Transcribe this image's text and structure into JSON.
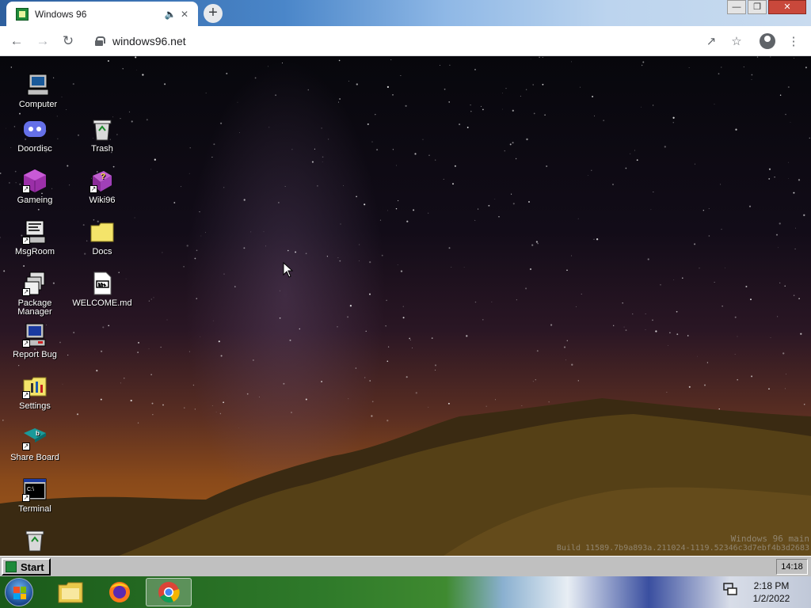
{
  "browser": {
    "tab_title": "Windows 96",
    "tab_audio_icon": "speaker-icon",
    "tab_close_icon": "close-icon",
    "new_tab_label": "+",
    "url": "windows96.net",
    "window_controls": [
      "minimize",
      "restore",
      "close"
    ]
  },
  "desktop": {
    "icons": [
      {
        "label": "Computer",
        "icon": "computer-icon"
      },
      {
        "label": "Doordisc",
        "icon": "discord-icon"
      },
      {
        "label": "Trash",
        "icon": "recycle-bin-icon"
      },
      {
        "label": "Gameing",
        "icon": "game-cube-icon"
      },
      {
        "label": "Wiki96",
        "icon": "help-book-icon"
      },
      {
        "label": "MsgRoom",
        "icon": "chat-icon"
      },
      {
        "label": "Docs",
        "icon": "folder-icon"
      },
      {
        "label": "Package Manager",
        "icon": "package-icon"
      },
      {
        "label": "WELCOME.md",
        "icon": "markdown-file-icon"
      },
      {
        "label": "Report Bug",
        "icon": "bug-report-icon"
      },
      {
        "label": "Settings",
        "icon": "settings-folder-icon"
      },
      {
        "label": "Share Board",
        "icon": "share-board-icon"
      },
      {
        "label": "Terminal",
        "icon": "terminal-icon"
      }
    ],
    "build_line1": "Windows 96 main",
    "build_line2": "Build 11589.7b9a893a.211024-1119.52346c3d7ebf4b3d2683"
  },
  "w96_taskbar": {
    "start_label": "Start",
    "clock": "14:18"
  },
  "host_taskbar": {
    "apps": [
      "file-explorer-icon",
      "firefox-icon",
      "chrome-icon"
    ],
    "time": "2:18 PM",
    "date": "1/2/2022"
  }
}
